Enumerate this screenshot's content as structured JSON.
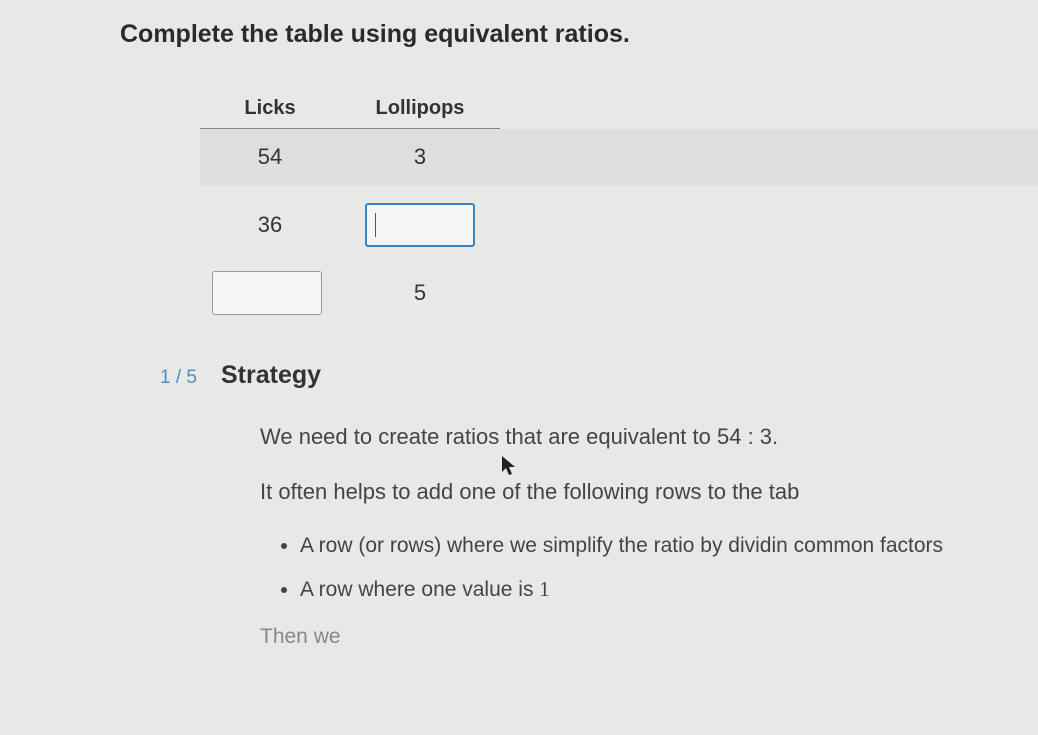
{
  "title": "Complete the table using equivalent ratios.",
  "table": {
    "headers": {
      "licks": "Licks",
      "lollipops": "Lollipops"
    },
    "rows": [
      {
        "licks": "54",
        "lollipops": "3"
      },
      {
        "licks": "36",
        "lollipops_input": ""
      },
      {
        "licks_input": "",
        "lollipops": "5"
      }
    ]
  },
  "step": {
    "counter": "1 / 5",
    "heading": "Strategy"
  },
  "body": {
    "p1_a": "We need to create ratios that are equivalent to ",
    "p1_ratio": "54 : 3",
    "p1_b": ".",
    "p2": "It often helps to add one of the following rows to the tab",
    "bullet1": "A row (or rows) where we simplify the ratio by dividin common factors",
    "bullet2_a": "A row where one value is ",
    "bullet2_b": "1",
    "cutoff": "Then we"
  }
}
